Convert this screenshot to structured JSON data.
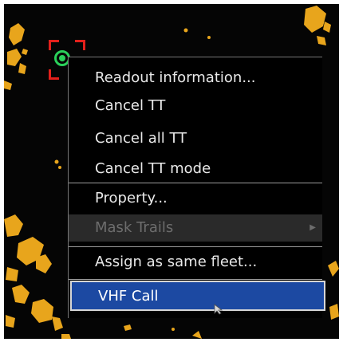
{
  "context_menu": {
    "items": [
      {
        "label": "Readout information...",
        "state": "enabled"
      },
      {
        "label": "Cancel TT",
        "state": "enabled"
      },
      {
        "label": "Cancel all TT",
        "state": "enabled"
      },
      {
        "label": "Cancel TT mode",
        "state": "enabled"
      },
      {
        "label": "Property...",
        "state": "enabled"
      },
      {
        "label": "Mask Trails",
        "state": "disabled",
        "has_submenu": true
      },
      {
        "label": "Assign as same fleet...",
        "state": "enabled"
      },
      {
        "label": "VHF Call",
        "state": "selected"
      }
    ]
  },
  "colors": {
    "radar_echo": "#e8a51c",
    "target_bracket": "#e3201b",
    "tt_symbol": "#2ad05a",
    "selection": "#1c49a2"
  },
  "icons": {
    "target_bracket": "target-selection-bracket-icon",
    "tt_symbol": "tracked-target-symbol-icon",
    "submenu": "submenu-arrow-icon",
    "pointer": "mouse-pointer-icon"
  }
}
